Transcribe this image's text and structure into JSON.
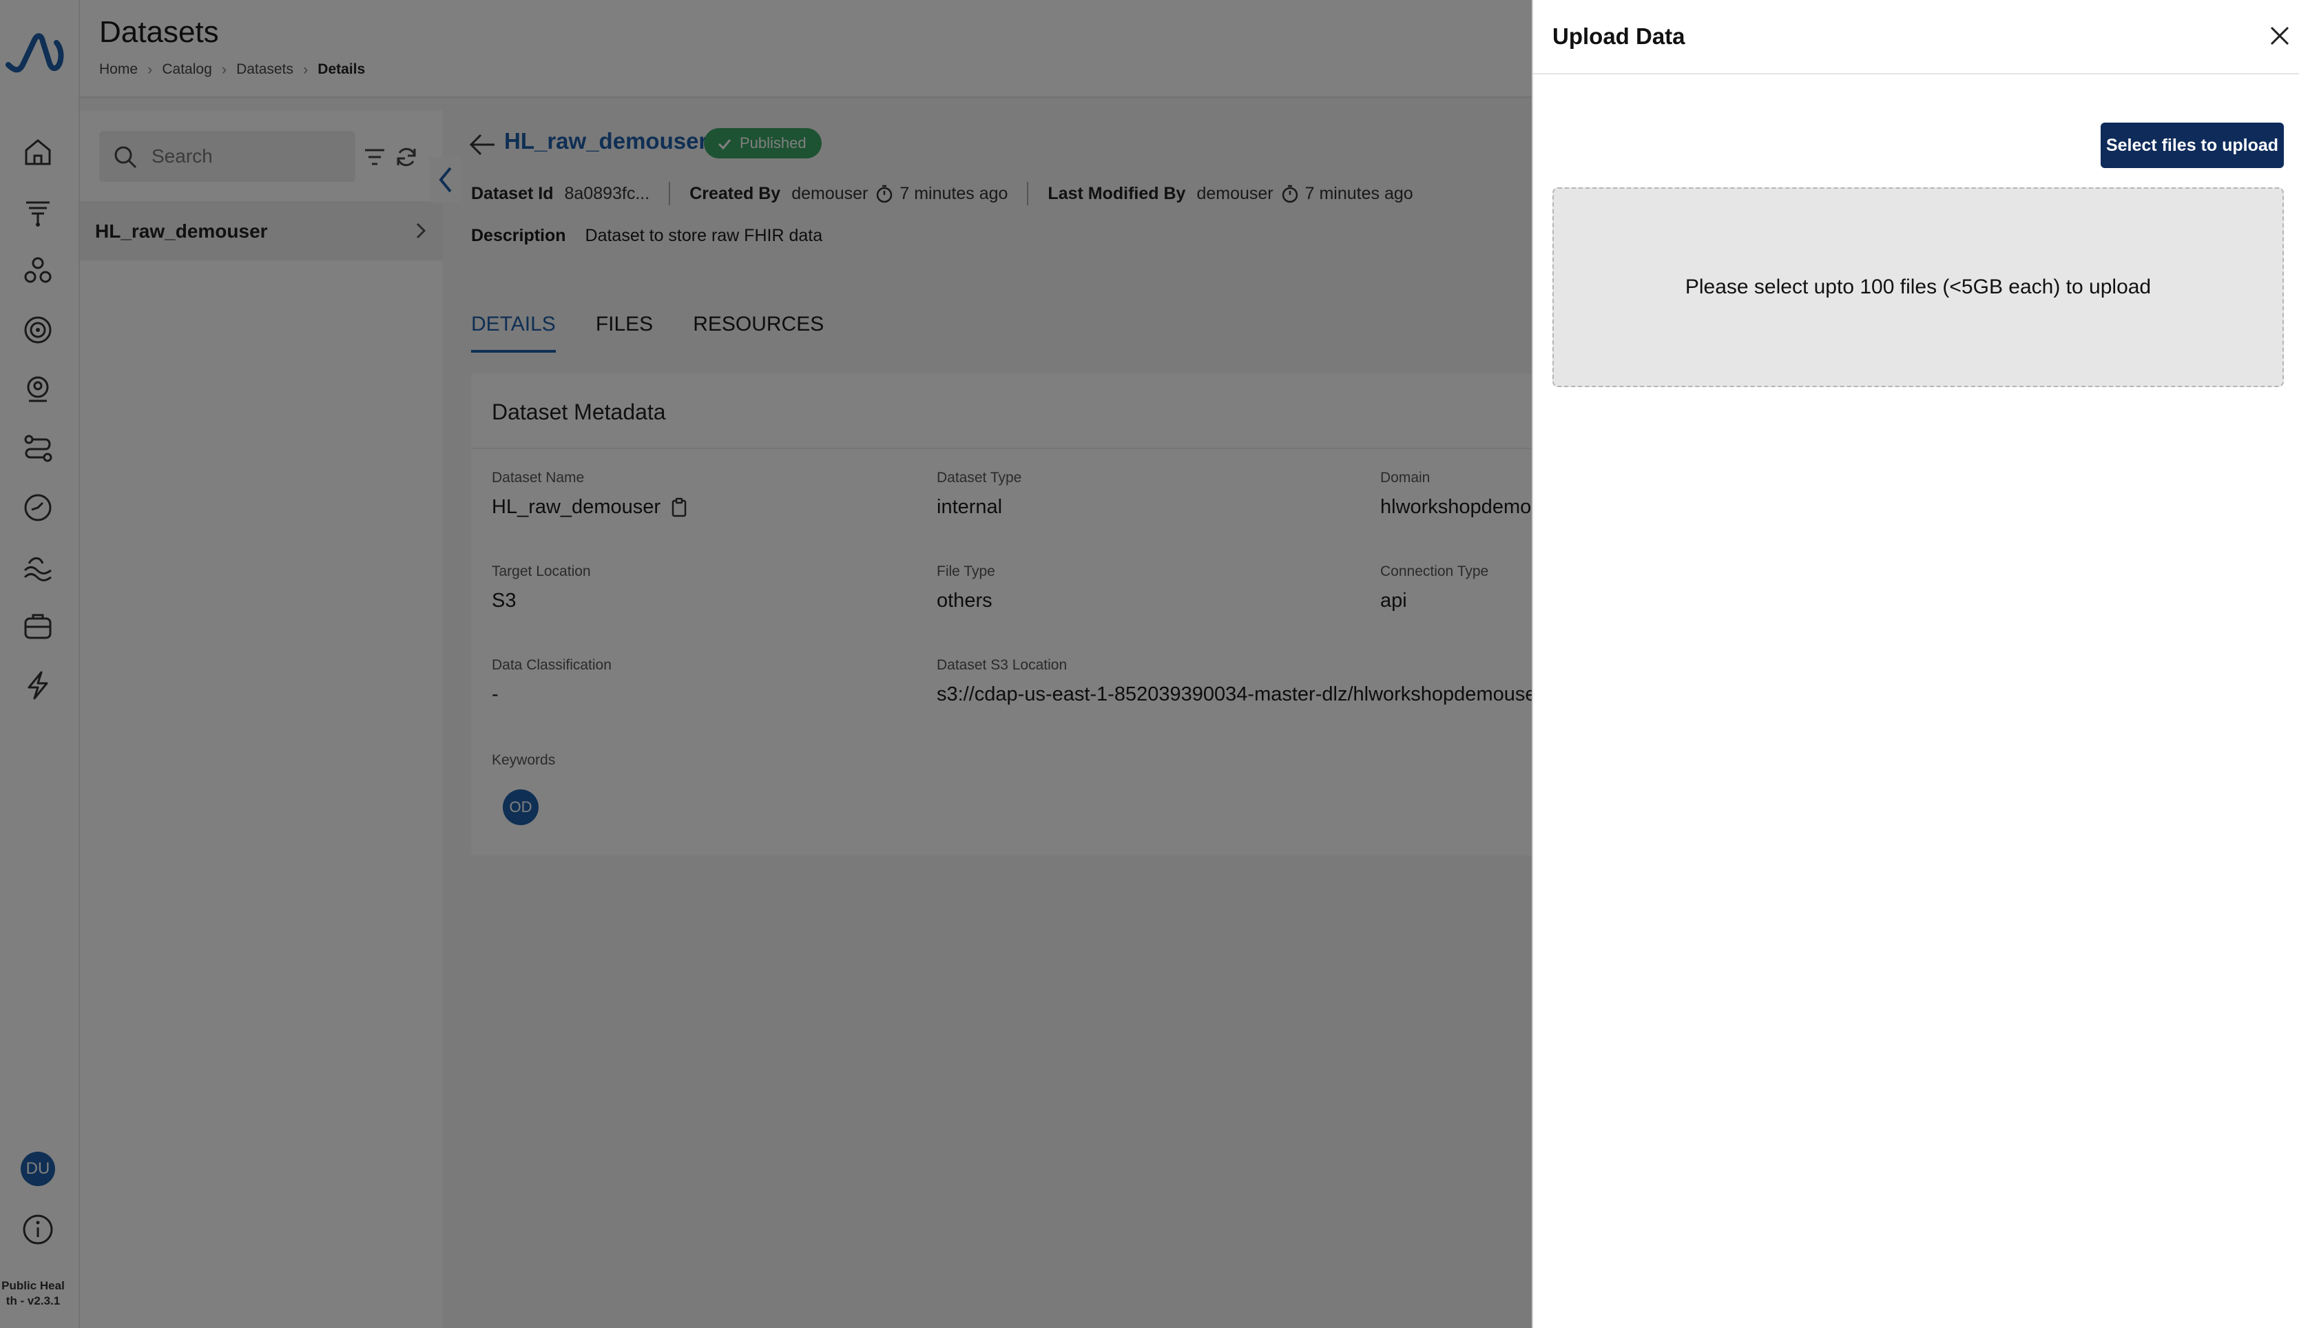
{
  "header": {
    "title": "Datasets",
    "breadcrumb": [
      "Home",
      "Catalog",
      "Datasets",
      "Details"
    ]
  },
  "sidebar": {
    "icons": [
      "home-icon",
      "pipeline-icon",
      "users-icon",
      "target-icon",
      "profile-icon",
      "workflow-icon",
      "clock-icon",
      "waves-icon",
      "briefcase-icon",
      "bolt-icon"
    ],
    "avatar_initials": "DU",
    "version_text": "Public Heal th - v2.3.1"
  },
  "list_panel": {
    "search_placeholder": "Search",
    "items": [
      {
        "label": "HL_raw_demouser"
      }
    ]
  },
  "dataset": {
    "title": "HL_raw_demouser",
    "status": "Published",
    "id_label": "Dataset Id",
    "id_value": "8a0893fc...",
    "created_by_label": "Created By",
    "created_by": "demouser",
    "created_time": "7 minutes ago",
    "modified_by_label": "Last Modified By",
    "modified_by": "demouser",
    "modified_time": "7 minutes ago",
    "description_label": "Description",
    "description": "Dataset to store raw FHIR data"
  },
  "tabs": [
    {
      "label": "DETAILS",
      "active": true
    },
    {
      "label": "FILES",
      "active": false
    },
    {
      "label": "RESOURCES",
      "active": false
    }
  ],
  "metadata": {
    "title": "Dataset Metadata",
    "fields": {
      "dataset_name": {
        "label": "Dataset Name",
        "value": "HL_raw_demouser"
      },
      "dataset_type": {
        "label": "Dataset Type",
        "value": "internal"
      },
      "domain": {
        "label": "Domain",
        "value": "hlworkshopdemo"
      },
      "target_location": {
        "label": "Target Location",
        "value": "S3"
      },
      "file_type": {
        "label": "File Type",
        "value": "others"
      },
      "connection_type": {
        "label": "Connection Type",
        "value": "api"
      },
      "data_classification": {
        "label": "Data Classification",
        "value": "-"
      },
      "s3_location": {
        "label": "Dataset S3 Location",
        "value": "s3://cdap-us-east-1-852039390034-master-dlz/hlworkshopdemouse"
      },
      "keywords": {
        "label": "Keywords",
        "value": "OD"
      }
    }
  },
  "upload_drawer": {
    "title": "Upload Data",
    "select_button": "Select files to upload",
    "dropzone_text": "Please select upto 100 files (<5GB each) to upload"
  },
  "colors": {
    "accent": "#1f5fa8",
    "button": "#0e2b5a",
    "badge": "#3aa564"
  }
}
